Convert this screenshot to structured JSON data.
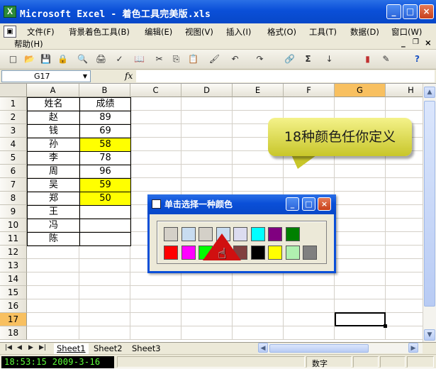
{
  "window": {
    "icon_letter": "X",
    "title": "Microsoft Excel - 着色工具完美版.xls",
    "minimize": "_",
    "maximize": "□",
    "close": "×"
  },
  "menu": {
    "items": [
      "文件(F)",
      "背景着色工具(B)",
      "编辑(E)",
      "视图(V)",
      "插入(I)",
      "格式(O)",
      "工具(T)",
      "数据(D)",
      "窗口(W)"
    ],
    "help": "帮助(H)",
    "doc_controls": [
      "_",
      "♂",
      "×"
    ]
  },
  "toolbar": {
    "icons": [
      "new-icon",
      "open-icon",
      "save-icon",
      "permission-icon",
      "print-preview-icon",
      "print-icon",
      "spell-icon",
      "research-icon",
      "cut-icon",
      "copy-icon",
      "paste-icon",
      "format-painter-icon",
      "undo-icon",
      "redo-icon",
      "hyperlink-icon",
      "autosum-icon",
      "sort-asc-icon",
      "chart-icon",
      "drawing-icon",
      "help-icon"
    ],
    "glyphs": [
      "□",
      "📂",
      "💾",
      "🔒",
      "🔍",
      "🖨",
      "✓",
      "📖",
      "✂",
      "⎘",
      "📋",
      "🖌",
      "↶",
      "↷",
      "🔗",
      "Σ",
      "↓",
      "▮",
      "✎",
      "?"
    ]
  },
  "formula_bar": {
    "name_box": "G17",
    "fx": "fx",
    "value": ""
  },
  "sheet": {
    "columns": [
      "A",
      "B",
      "C",
      "D",
      "E",
      "F",
      "G",
      "H"
    ],
    "selected_column": "G",
    "rows": [
      "1",
      "2",
      "3",
      "4",
      "5",
      "6",
      "7",
      "8",
      "9",
      "10",
      "11",
      "12",
      "13",
      "14",
      "15",
      "16",
      "17",
      "18"
    ],
    "selected_row": "17",
    "table": {
      "headers": [
        "姓名",
        "成绩"
      ],
      "records": [
        {
          "name": "赵",
          "score": "89",
          "highlight": false
        },
        {
          "name": "钱",
          "score": "69",
          "highlight": false
        },
        {
          "name": "孙",
          "score": "58",
          "highlight": true
        },
        {
          "name": "李",
          "score": "78",
          "highlight": false
        },
        {
          "name": "周",
          "score": "96",
          "highlight": false
        },
        {
          "name": "吴",
          "score": "59",
          "highlight": true
        },
        {
          "name": "郑",
          "score": "50",
          "highlight": true
        },
        {
          "name": "王",
          "score": "",
          "highlight": false
        },
        {
          "name": "冯",
          "score": "",
          "highlight": false
        },
        {
          "name": "陈",
          "score": "",
          "highlight": false
        }
      ],
      "highlight_color": "#ffff00"
    }
  },
  "callout": {
    "text": "18种颜色任你定义",
    "color": "#e6e45a"
  },
  "color_dialog": {
    "title": "单击选择一种颜色",
    "minimize": "_",
    "maximize": "□",
    "close": "×",
    "swatches": [
      "#d4d0c8",
      "#c8dcf0",
      "#d4d0c8",
      "#c8dcf0",
      "#dcdcf0",
      "#00ffff",
      "#800080",
      "#008000",
      "#ff0000",
      "#ff00ff",
      "#00ff00",
      "#111111",
      "#804040",
      "#000000",
      "#ffff00",
      "#b0f0b0",
      "#808080"
    ]
  },
  "sheet_tabs": {
    "nav": [
      "|◀",
      "◀",
      "▶",
      "▶|"
    ],
    "tabs": [
      "Sheet1",
      "Sheet2",
      "Sheet3"
    ],
    "active": "Sheet1"
  },
  "status": {
    "clock": "18:53:15  2009-3-16",
    "mode": "数字"
  }
}
